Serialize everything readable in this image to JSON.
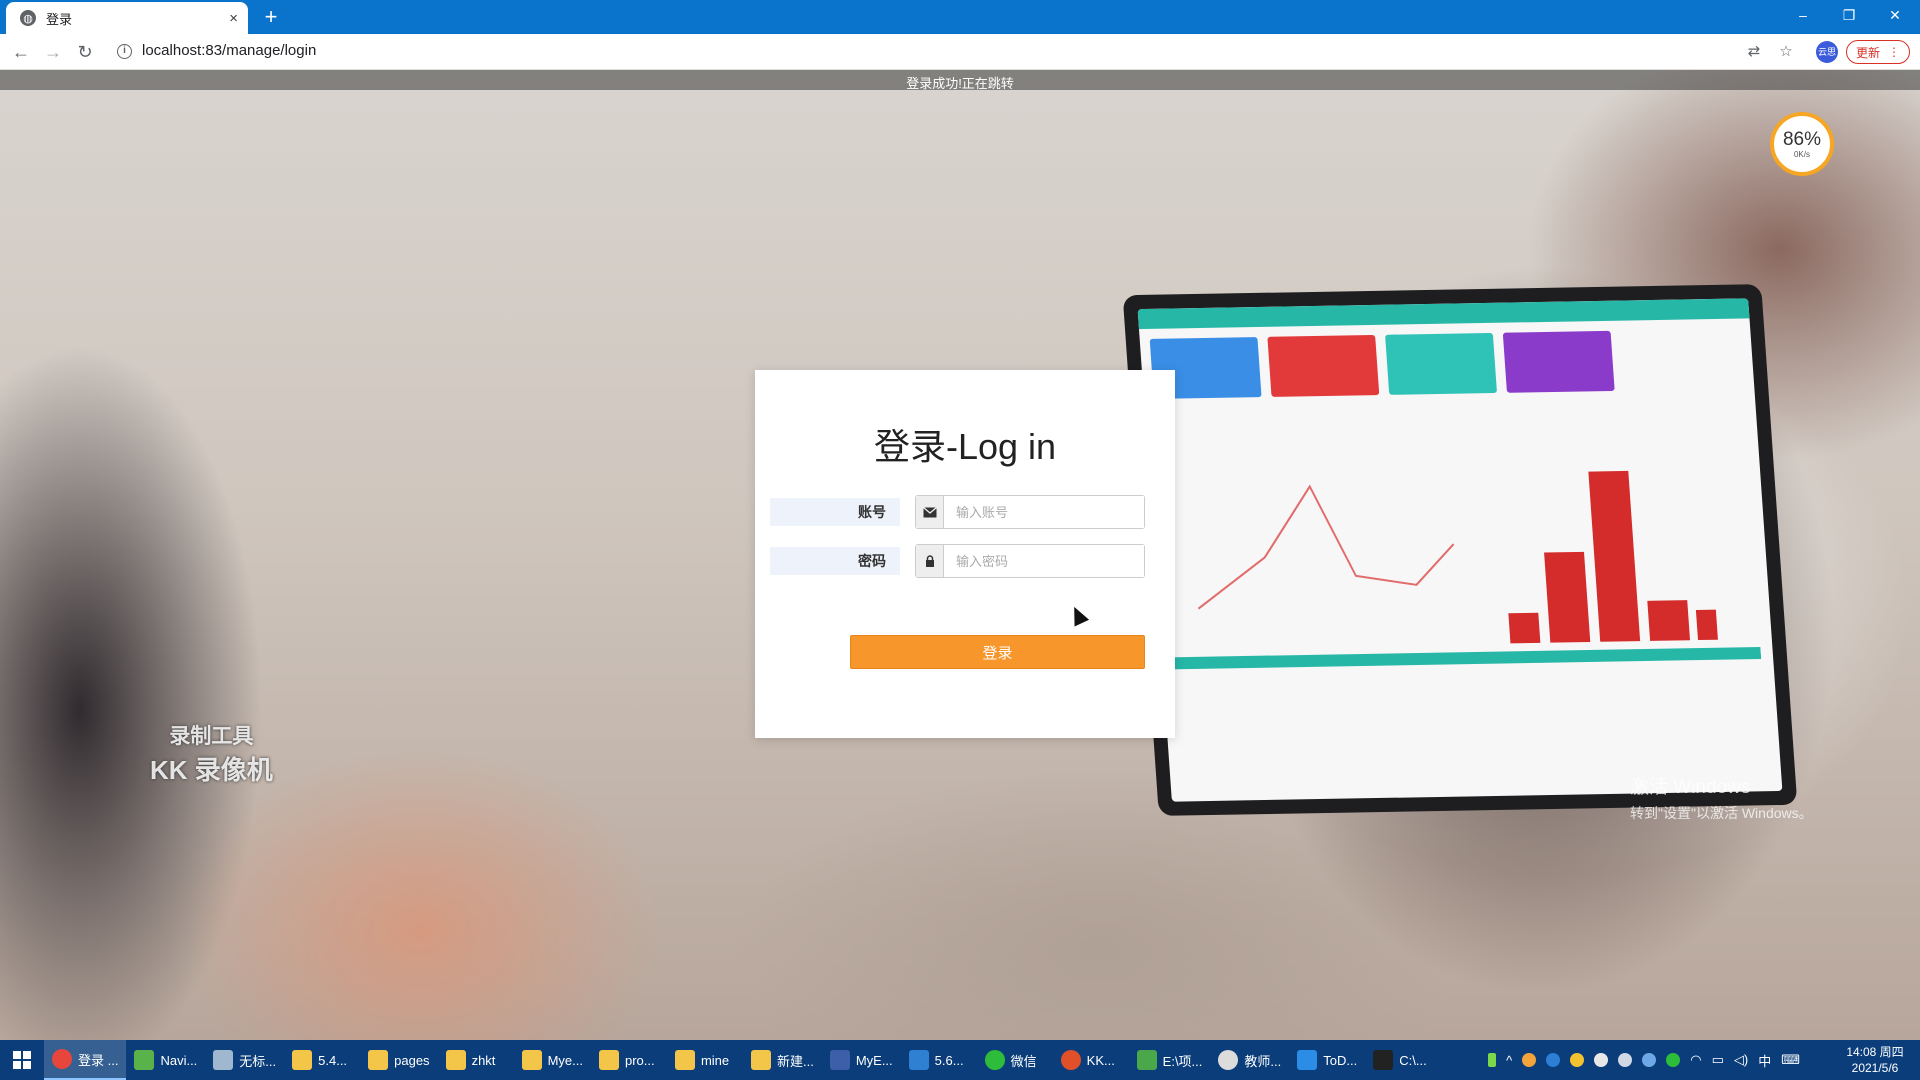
{
  "browser": {
    "tab_title": "登录",
    "tab_close": "×",
    "new_tab": "+",
    "url": "localhost:83/manage/login",
    "profile_label": "云思",
    "update_label": "更新",
    "window_controls": {
      "minimize": "–",
      "restore": "❐",
      "close": "✕"
    }
  },
  "page": {
    "notice": "登录成功!正在跳转",
    "speed_widget": {
      "percent": "86%",
      "rate": "0K/s"
    },
    "watermark_line1": "录制工具",
    "watermark_line2": "KK 录像机",
    "activate_line1": "激活 Windows",
    "activate_line2": "转到\"设置\"以激活 Windows。"
  },
  "login": {
    "title": "登录-Log in",
    "account_label": "账号",
    "account_placeholder": "输入账号",
    "account_icon": "envelope-icon",
    "password_label": "密码",
    "password_placeholder": "输入密码",
    "password_icon": "lock-icon",
    "submit_label": "登录",
    "accent_color": "#f7962a"
  },
  "taskbar": {
    "items": [
      {
        "label": "登录 ...",
        "icon": "chrome-icon",
        "color": "#e8453c"
      },
      {
        "label": "Navi...",
        "icon": "navicat-icon",
        "color": "#5ab34a"
      },
      {
        "label": "无标...",
        "icon": "paint-icon",
        "color": "#9fb7cf"
      },
      {
        "label": "5.4...",
        "icon": "folder-icon",
        "color": "#f3c548"
      },
      {
        "label": "pages",
        "icon": "folder-icon",
        "color": "#f3c548"
      },
      {
        "label": "zhkt",
        "icon": "folder-icon",
        "color": "#f3c548"
      },
      {
        "label": "Mye...",
        "icon": "folder-icon",
        "color": "#f3c548"
      },
      {
        "label": "pro...",
        "icon": "folder-icon",
        "color": "#f3c548"
      },
      {
        "label": "mine",
        "icon": "folder-icon",
        "color": "#f3c548"
      },
      {
        "label": "新建...",
        "icon": "folder-icon",
        "color": "#f3c548"
      },
      {
        "label": "MyE...",
        "icon": "myeclipse-icon",
        "color": "#3d5ea8"
      },
      {
        "label": "5.6...",
        "icon": "vscode-icon",
        "color": "#2f7fd3"
      },
      {
        "label": "微信",
        "icon": "wechat-icon",
        "color": "#2dbd3a"
      },
      {
        "label": "KK...",
        "icon": "kk-icon",
        "color": "#e2502a"
      },
      {
        "label": "E:\\项...",
        "icon": "editor-icon",
        "color": "#4aa84a"
      },
      {
        "label": "教师...",
        "icon": "chat-icon",
        "color": "#dcdcdc"
      },
      {
        "label": "ToD...",
        "icon": "todo-icon",
        "color": "#2b8de6"
      },
      {
        "label": "C:\\...",
        "icon": "terminal-icon",
        "color": "#222222"
      }
    ],
    "ime": "中",
    "time": "14:08 周四",
    "date": "2021/5/6"
  }
}
